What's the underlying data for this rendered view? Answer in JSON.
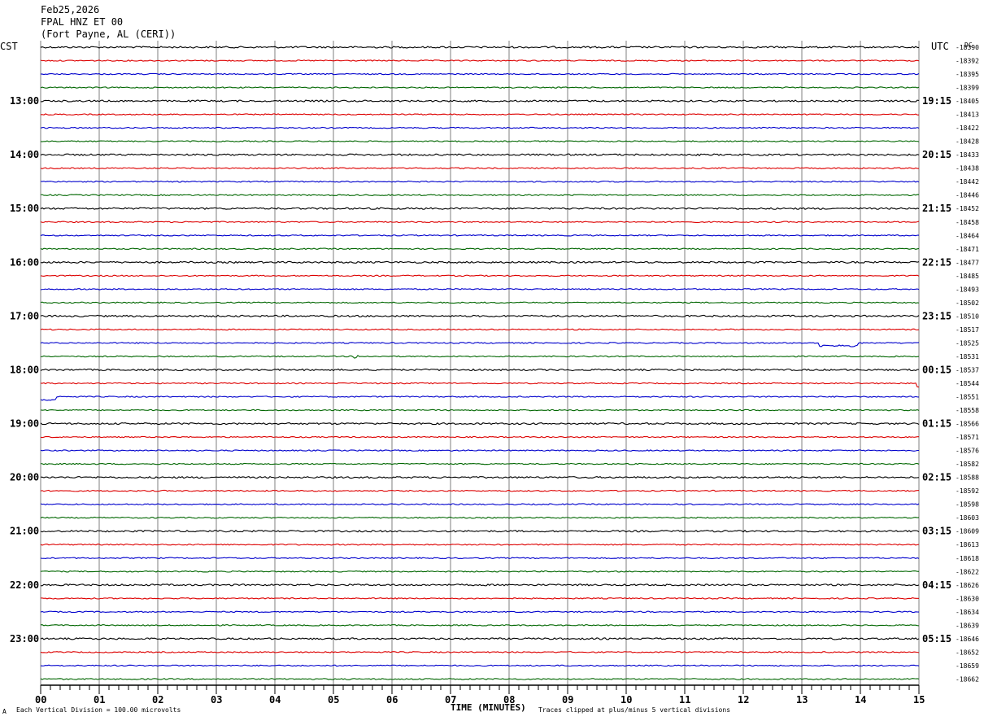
{
  "header": {
    "date": "Feb25,2026",
    "station": "FPAL HNZ ET 00",
    "location": "(Fort Payne, AL (CERI))"
  },
  "left_zone": "CST",
  "right_zone": "UTC",
  "dc_label": "DC",
  "footer": {
    "scale_note": "Each Vertical Division =  100.00 microvolts",
    "clip_note": "Traces clipped at plus/minus 5 vertical divisions",
    "corner_mark": "A"
  },
  "colors": {
    "cycle": [
      "#000000",
      "#dd0000",
      "#0000cc",
      "#006600"
    ],
    "grid": "#7f7f7f"
  },
  "chart_data": {
    "type": "line",
    "title": "",
    "xlabel": "TIME (MINUTES)",
    "x_ticks": [
      "00",
      "01",
      "02",
      "03",
      "04",
      "05",
      "06",
      "07",
      "08",
      "09",
      "10",
      "11",
      "12",
      "13",
      "14",
      "15"
    ],
    "xlim": [
      0,
      15
    ],
    "left_hour_labels": [
      "13:00",
      "14:00",
      "15:00",
      "16:00",
      "17:00",
      "18:00",
      "19:00",
      "20:00",
      "21:00",
      "22:00",
      "23:00"
    ],
    "right_hour_labels": [
      "19:15",
      "20:15",
      "21:15",
      "22:15",
      "23:15",
      "00:15",
      "01:15",
      "02:15",
      "03:15",
      "04:15",
      "05:15"
    ],
    "dc_values": [
      "-18390",
      "-18392",
      "-18395",
      "-18399",
      "-18405",
      "-18413",
      "-18422",
      "-18428",
      "-18433",
      "-18438",
      "-18442",
      "-18446",
      "-18452",
      "-18458",
      "-18464",
      "-18471",
      "-18477",
      "-18485",
      "-18493",
      "-18502",
      "-18510",
      "-18517",
      "-18525",
      "-18531",
      "-18537",
      "-18544",
      "-18551",
      "-18558",
      "-18566",
      "-18571",
      "-18576",
      "-18582",
      "-18588",
      "-18592",
      "-18598",
      "-18603",
      "-18609",
      "-18613",
      "-18618",
      "-18622",
      "-18626",
      "-18630",
      "-18634",
      "-18639",
      "-18646",
      "-18652",
      "-18659",
      "-18662"
    ],
    "events": [
      {
        "trace": 23,
        "start_min": 5.35,
        "end_min": 5.45,
        "note": "small spike"
      },
      {
        "trace": 22,
        "start_min": 13.3,
        "end_min": 13.95,
        "note": "step offset"
      },
      {
        "trace": 26,
        "start_min": 0.0,
        "end_min": 0.25,
        "note": "dip"
      },
      {
        "trace": 25,
        "start_min": 14.95,
        "end_min": 15.0,
        "note": "end drop"
      }
    ]
  }
}
